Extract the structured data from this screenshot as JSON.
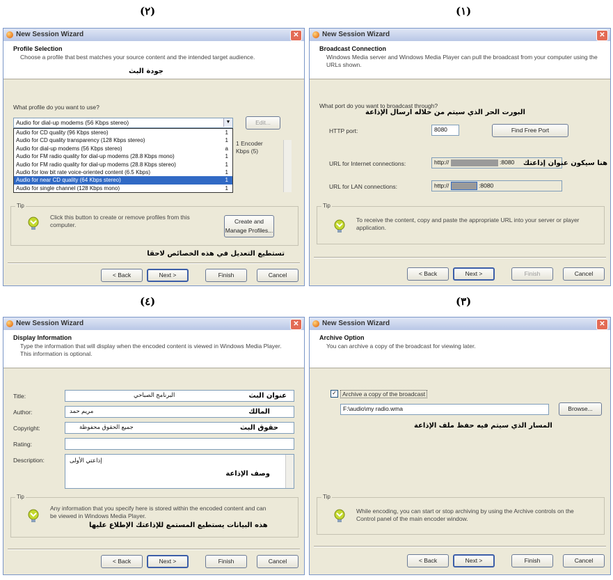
{
  "captions": {
    "p1": "(١)",
    "p2": "(٢)",
    "p3": "(٣)",
    "p4": "(٤)"
  },
  "window_title": "New Session Wizard",
  "nav": {
    "back": "< Back",
    "next": "Next >",
    "finish": "Finish",
    "cancel": "Cancel"
  },
  "tip_label": "Tip",
  "panel1": {
    "header_title": "Broadcast Connection",
    "header_desc": "Windows Media server and Windows Media Player can pull the broadcast from your computer using the URLs shown.",
    "question": "What port do you want to broadcast through?",
    "arabic_port": "البورت الحر الذي سيتم من خلاله ارسال الإذاعة",
    "http_port_label": "HTTP port:",
    "http_port_value": "8080",
    "find_free_port": "Find Free Port",
    "internet_label": "URL for Internet connections:",
    "internet_value": "http://",
    "internet_port": ":8080",
    "arabic_url": "هنا سيكون عنوان إذاعتك",
    "lan_label": "URL for LAN connections:",
    "lan_value": "http://",
    "lan_port": ":8080",
    "tip_text": "To receive the content, copy and paste the appropriate URL into your server or player application."
  },
  "panel2": {
    "header_title": "Profile Selection",
    "header_desc": "Choose a profile that best matches your source content and the intended target audience.",
    "arabic_header": "جودة البث",
    "question": "What profile do you want to use?",
    "selected_profile": "Audio for dial-up modems (56 Kbps stereo)",
    "edit_button": "Edit...",
    "profiles": [
      {
        "name": "Audio for CD quality (96 Kbps stereo)",
        "sfx": "1"
      },
      {
        "name": "Audio for CD quality transparency (128 Kbps stereo)",
        "sfx": "1"
      },
      {
        "name": "Audio for dial-up modems (56 Kbps stereo)",
        "sfx": "a"
      },
      {
        "name": "Audio for FM radio quality for dial-up modems (28.8 Kbps mono)",
        "sfx": "1"
      },
      {
        "name": "Audio for FM radio quality for dial-up modems (28.8 Kbps stereo)",
        "sfx": "1"
      },
      {
        "name": "Audio for low bit rate voice-oriented content (6.5 Kbps)",
        "sfx": "1"
      },
      {
        "name": "Audio for near CD quality (64 Kbps stereo)",
        "sfx": "1"
      },
      {
        "name": "Audio for single channel (128 Kbps mono)",
        "sfx": "1"
      }
    ],
    "right_text_1": "1 Encoder",
    "right_text_2": "Kbps (5)",
    "tip_text": "Click this button to create or remove profiles from this computer.",
    "manage_button": "Create and Manage Profiles...",
    "arabic_footer": "تستطيع التعديل في هذه الخصائص لاحقا"
  },
  "panel3": {
    "header_title": "Archive Option",
    "header_desc": "You can archive a copy of the broadcast for viewing later.",
    "archive_checkbox": "Archive a copy of the broadcast",
    "archive_checked": true,
    "archive_path": "F:\\audio\\my radio.wma",
    "browse": "Browse...",
    "arabic_path": "المسار الذي سيتم فيه حفظ ملف الإذاعة",
    "tip_text": "While encoding, you can start or stop archiving by using the Archive controls on the Control panel of the main encoder window."
  },
  "panel4": {
    "header_title": "Display Information",
    "header_desc": "Type the information that will display when the encoded content is viewed in Windows Media Player.",
    "header_desc2": "This information is optional.",
    "title_label": "Title:",
    "title_value": "البرنامج الصباحي",
    "title_ar": "عنوان البث",
    "author_label": "Author:",
    "author_value": "مريم حمد",
    "author_ar": "المالك",
    "copyright_label": "Copyright:",
    "copyright_value": "جميع الحقوق محفوظة",
    "copyright_ar": "حقوق البث",
    "rating_label": "Rating:",
    "rating_value": "",
    "description_label": "Description:",
    "description_value": "إذاعتي الأولى",
    "description_ar": "وصف الإذاعة",
    "tip_text": "Any information that you specify here is stored within the encoded content and can be viewed in Windows Media Player.",
    "arabic_tip": "هذه البيانات يستطيع المستمع للإذاعتك الإطلاع عليها"
  }
}
